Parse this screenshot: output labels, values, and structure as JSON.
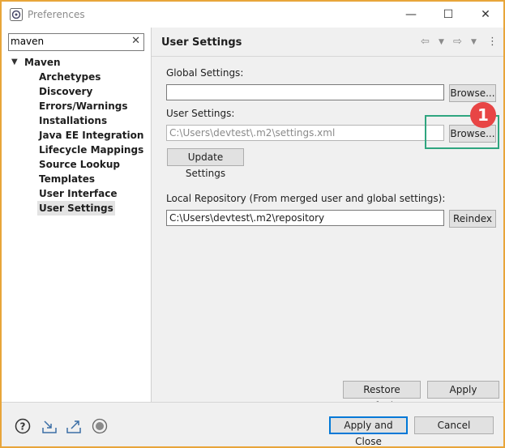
{
  "window": {
    "title": "Preferences"
  },
  "filter": {
    "value": "maven"
  },
  "tree": {
    "root": "Maven",
    "items": [
      "Archetypes",
      "Discovery",
      "Errors/Warnings",
      "Installations",
      "Java EE Integration",
      "Lifecycle Mappings",
      "Source Lookup",
      "Templates",
      "User Interface",
      "User Settings"
    ],
    "selected": "User Settings"
  },
  "page": {
    "title": "User Settings",
    "global_label": "Global Settings:",
    "global_value": "",
    "browse1": "Browse...",
    "user_label": "User Settings:",
    "user_value": "C:\\Users\\devtest\\.m2\\settings.xml",
    "browse2": "Browse...",
    "update_btn": "Update Settings",
    "local_label": "Local Repository (From merged user and global settings):",
    "local_value": "C:\\Users\\devtest\\.m2\\repository",
    "reindex": "Reindex",
    "restore": "Restore Defaults",
    "apply": "Apply"
  },
  "annotation": {
    "badge": "1",
    "color": "#e84545",
    "box_color": "#2fa57f"
  },
  "footer": {
    "apply_close": "Apply and Close",
    "cancel": "Cancel"
  }
}
